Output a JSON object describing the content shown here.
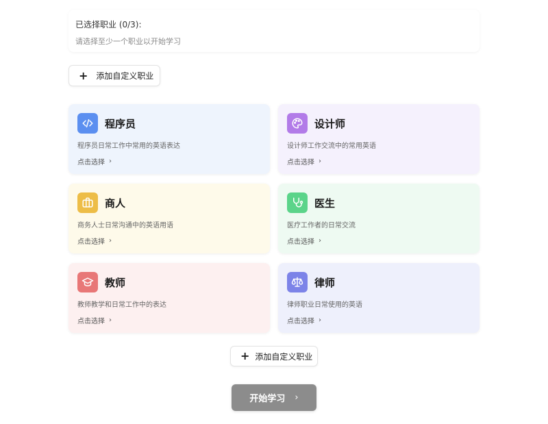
{
  "selected": {
    "title": "已选择职业 (0/3):",
    "hint": "请选择至少一个职业以开始学习"
  },
  "add_custom": {
    "top_label": "添加自定义职业",
    "bottom_label": "添加自定义职业",
    "plus": "+"
  },
  "cards": [
    {
      "name": "程序员",
      "desc": "程序员日常工作中常用的英语表达",
      "select": "点击选择",
      "icon": "code-icon",
      "bg": "#eef4fd",
      "icon_bg": "#5b8ff0"
    },
    {
      "name": "设计师",
      "desc": "设计师工作交流中的常用英语",
      "select": "点击选择",
      "icon": "palette-icon",
      "bg": "#f5f1fd",
      "icon_bg": "#b27be8"
    },
    {
      "name": "商人",
      "desc": "商务人士日常沟通中的英语用语",
      "select": "点击选择",
      "icon": "briefcase-icon",
      "bg": "#fefaea",
      "icon_bg": "#edbd47"
    },
    {
      "name": "医生",
      "desc": "医疗工作者的日常交流",
      "select": "点击选择",
      "icon": "stethoscope-icon",
      "bg": "#eefaf2",
      "icon_bg": "#5bd48a"
    },
    {
      "name": "教师",
      "desc": "教师教学和日常工作中的表达",
      "select": "点击选择",
      "icon": "graduation-cap-icon",
      "bg": "#fdf0f0",
      "icon_bg": "#e87777"
    },
    {
      "name": "律师",
      "desc": "律师职业日常使用的英语",
      "select": "点击选择",
      "icon": "scales-icon",
      "bg": "#eef0fc",
      "icon_bg": "#7c83e8"
    }
  ],
  "chevron": "›",
  "start": {
    "label": "开始学习",
    "bg": "#8c8c8c"
  }
}
